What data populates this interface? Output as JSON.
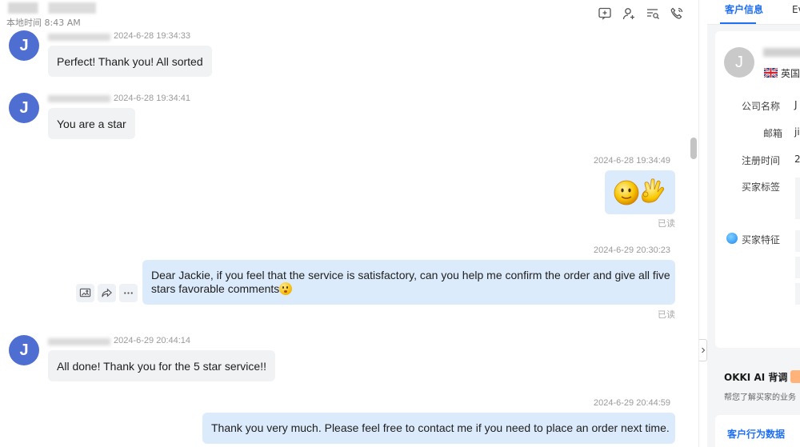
{
  "header": {
    "local_time_label": "本地时间 8:43 AM",
    "icons": [
      "add-note-icon",
      "add-contact-icon",
      "search-list-icon",
      "phone-icon"
    ]
  },
  "messages": [
    {
      "direction": "in",
      "avatar_letter": "J",
      "timestamp": "2024-6-28 19:34:33",
      "text": "Perfect! Thank you! All sorted"
    },
    {
      "direction": "in",
      "avatar_letter": "J",
      "timestamp": "2024-6-28 19:34:41",
      "text": "You are a star"
    },
    {
      "direction": "out",
      "timestamp": "2024-6-28 19:34:49",
      "content": "emoji-smile-ok",
      "status": "已读"
    },
    {
      "direction": "out",
      "timestamp": "2024-6-29 20:30:23",
      "text_line1": "Dear Jackie, if you feel that the service is satisfactory, can you help me confirm the order and give all five",
      "text_line2": "stars favorable comments",
      "status": "已读"
    },
    {
      "direction": "in",
      "avatar_letter": "J",
      "timestamp": "2024-6-29 20:44:14",
      "text": "All done! Thank you for the 5 star service!!"
    },
    {
      "direction": "out",
      "timestamp": "2024-6-29 20:44:59",
      "text": "Thank you very much. Please feel free to contact me if you need to place an order next time."
    }
  ],
  "message_actions": [
    "image-icon",
    "forward-icon",
    "more-icon"
  ],
  "right_panel": {
    "tabs": [
      "客户信息",
      "Ev"
    ],
    "avatar_letter": "J",
    "country": "英国",
    "fields": [
      {
        "label": "公司名称",
        "value": "J"
      },
      {
        "label": "邮箱",
        "value": "ji"
      },
      {
        "label": "注册时间",
        "value": "2"
      },
      {
        "label": "买家标签",
        "value": ""
      },
      {
        "label": "买家特征",
        "value": ""
      }
    ],
    "ai_title": "OKKI AI 背调",
    "ai_subtitle": "帮您了解买家的业务",
    "behavior_title": "客户行为数据"
  }
}
